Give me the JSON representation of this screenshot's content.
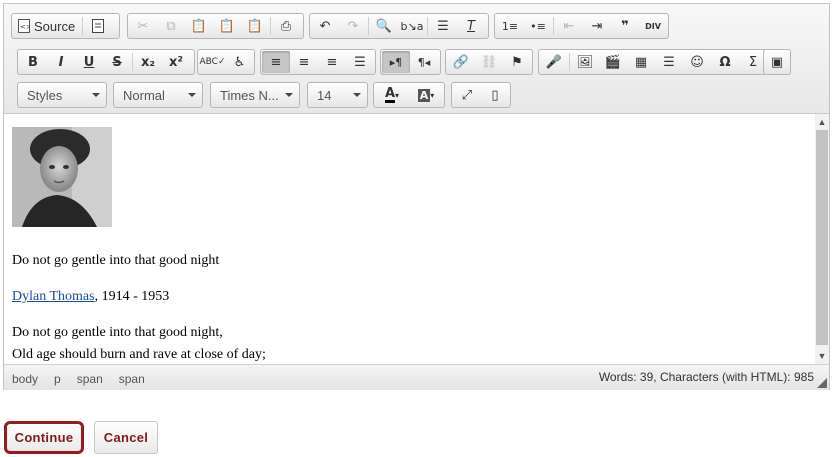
{
  "toolbar": {
    "source_label": "Source",
    "styles_label": "Styles",
    "format_label": "Normal",
    "font_label": "Times N...",
    "size_label": "14"
  },
  "content": {
    "line1": "Do not go gentle into that good night",
    "author_link": "Dylan Thomas",
    "author_years": ", 1914 - 1953",
    "line3": "Do not go gentle into that good night,",
    "line4": "Old age should burn and rave at close of day;"
  },
  "statusbar": {
    "path": [
      "body",
      "p",
      "span",
      "span"
    ],
    "counts": "Words: 39, Characters (with HTML): 985"
  },
  "actions": {
    "continue_label": "Continue",
    "cancel_label": "Cancel"
  },
  "colors": {
    "accent": "#9a1a1a",
    "link": "#1a4ea0"
  }
}
